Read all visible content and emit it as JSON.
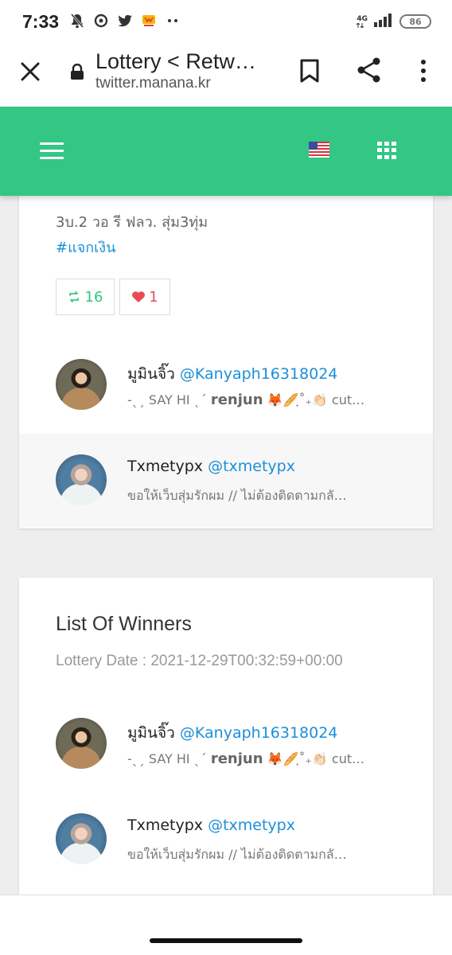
{
  "status_bar": {
    "time": "7:33",
    "network": "4G",
    "battery": "86"
  },
  "browser": {
    "tab_title": "Lottery < Retw…",
    "url": "twitter.manana.kr"
  },
  "header": {
    "accent_color": "#33c684",
    "flag": "🇺🇸"
  },
  "tweet": {
    "text_line": "3บ.2 วอ รี ฟลว. สุ่ม3ทุ่ม",
    "hashtag": "#แจกเงิน",
    "retweet_count": "16",
    "like_count": "1"
  },
  "participants": [
    {
      "name": "มูมินจิ๊ว",
      "handle": "@Kanyaph16318024",
      "bio_prefix": "-ˎˏ SAY HI ˎˊ",
      "bio_bold": "renjun",
      "bio_suffix": "🦊🥖ฺ˚₊👏🏻 cut…"
    },
    {
      "name": "Txmetypx",
      "handle": "@txmetypx",
      "bio": "ขอให้เว็บสุ่มรักผม // ไม่ต้องติดตามกลั…"
    }
  ],
  "winners_section": {
    "title": "List Of Winners",
    "lottery_date": "Lottery Date : 2021-12-29T00:32:59+00:00",
    "winners": [
      {
        "name": "มูมินจิ๊ว",
        "handle": "@Kanyaph16318024",
        "bio_prefix": "-ˎˏ SAY HI ˎˊ",
        "bio_bold": "renjun",
        "bio_suffix": "🦊🥖ฺ˚₊👏🏻 cut…"
      },
      {
        "name": "Txmetypx",
        "handle": "@txmetypx",
        "bio": "ขอให้เว็บสุ่มรักผม // ไม่ต้องติดตามกลั…"
      }
    ]
  }
}
